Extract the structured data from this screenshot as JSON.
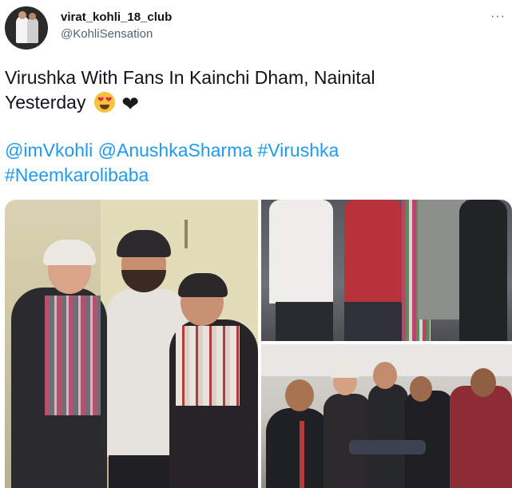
{
  "tweet": {
    "display_name": "virat_kohli_18_club",
    "handle": "@KohliSensation",
    "more_label": "···",
    "text_line1": "Virushka With Fans In Kainchi Dham, Nainital",
    "text_line2": "Yesterday",
    "emojis": [
      "heart-eyes-emoji",
      "black-heart-emoji"
    ],
    "black_heart": "❤",
    "hashtags": {
      "mention1": "@imVkohli",
      "mention2": "@AnushkaSharma",
      "tag1": "#Virushka",
      "tag2": "#Neemkarolibaba"
    },
    "link_color": "#1d9bf0"
  },
  "media": {
    "photos": [
      "photo-main",
      "photo-top-right",
      "photo-bottom-right"
    ]
  }
}
